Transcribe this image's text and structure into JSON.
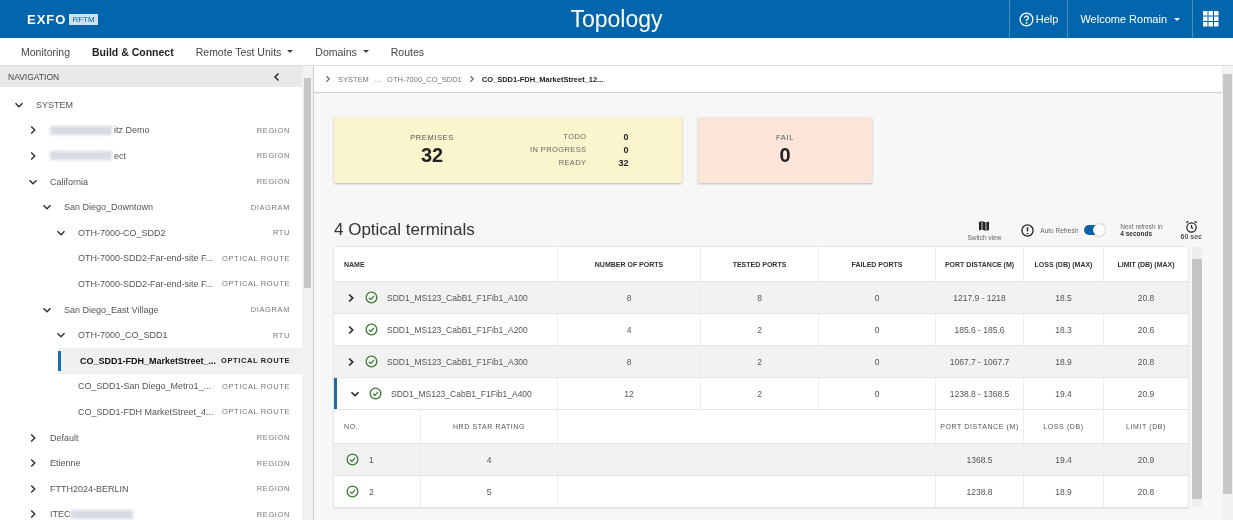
{
  "header": {
    "logo": "EXFO",
    "logo_badge": "RFTM",
    "title": "Topology",
    "help": "Help",
    "user": "Welcome Romain"
  },
  "menu": [
    {
      "label": "Monitoring",
      "selected": false,
      "dropdown": false
    },
    {
      "label": "Build & Connect",
      "selected": true,
      "dropdown": false
    },
    {
      "label": "Remote Test Units",
      "selected": false,
      "dropdown": true
    },
    {
      "label": "Domains",
      "selected": false,
      "dropdown": true
    },
    {
      "label": "Routes",
      "selected": false,
      "dropdown": false
    }
  ],
  "navigation": {
    "title": "NAVIGATION",
    "tree": [
      {
        "label": "SYSTEM",
        "kind": "group",
        "expanded": true,
        "selected": false,
        "children": [
          {
            "label": "itz Demo",
            "type": "REGION",
            "kind": "group",
            "expanded": false,
            "selected": false,
            "blurred_before": true
          },
          {
            "label": "ect",
            "type": "REGION",
            "kind": "group",
            "expanded": false,
            "selected": false,
            "blurred_before": true
          },
          {
            "label": "California",
            "type": "REGION",
            "kind": "group",
            "expanded": true,
            "selected": false,
            "children": [
              {
                "label": "San Diego_Downtown",
                "type": "DIAGRAM",
                "kind": "group",
                "expanded": true,
                "selected": false,
                "children": [
                  {
                    "label": "OTH-7000-CO_SDD2",
                    "type": "RTU",
                    "kind": "group",
                    "expanded": true,
                    "selected": false,
                    "children": [
                      {
                        "label": "OTH-7000-SDD2-Far-end-site F...",
                        "type": "OPTICAL ROUTE",
                        "kind": "leaf",
                        "selected": false
                      },
                      {
                        "label": "OTH-7000-SDD2-Far-end-site F...",
                        "type": "OPTICAL ROUTE",
                        "kind": "leaf",
                        "selected": false
                      }
                    ]
                  }
                ]
              },
              {
                "label": "San Diego_East Village",
                "type": "DIAGRAM",
                "kind": "group",
                "expanded": true,
                "selected": false,
                "children": [
                  {
                    "label": "OTH-7000_CO_SDD1",
                    "type": "RTU",
                    "kind": "group",
                    "expanded": true,
                    "selected": false,
                    "children": [
                      {
                        "label": "CO_SDD1-FDH_MarketStreet_...",
                        "type": "OPTICAL ROUTE",
                        "kind": "leaf",
                        "selected": true
                      },
                      {
                        "label": "CO_SDD1-San Diego_Metro1_...",
                        "type": "OPTICAL ROUTE",
                        "kind": "leaf",
                        "selected": false
                      },
                      {
                        "label": "CO_SDD1-FDH MarketStreet_4...",
                        "type": "OPTICAL ROUTE",
                        "kind": "leaf",
                        "selected": false
                      }
                    ]
                  }
                ]
              }
            ]
          },
          {
            "label": "Default",
            "type": "REGION",
            "kind": "group",
            "expanded": false,
            "selected": false
          },
          {
            "label": "Etienne",
            "type": "REGION",
            "kind": "group",
            "expanded": false,
            "selected": false
          },
          {
            "label": "FTTH2024-BERLIN",
            "type": "REGION",
            "kind": "group",
            "expanded": false,
            "selected": false
          },
          {
            "label": "ITEC",
            "type": "REGION",
            "kind": "group",
            "expanded": false,
            "selected": false,
            "blurred_after": true
          }
        ]
      }
    ]
  },
  "breadcrumb": [
    {
      "label": "SYSTEM",
      "current": false
    },
    {
      "label": "...",
      "current": false
    },
    {
      "label": "OTH-7000_CO_SDD1",
      "current": false
    },
    {
      "label": "CO_SDD1-FDH_MarketStreet_12...",
      "current": true
    }
  ],
  "summary": {
    "premises_label": "PREMISES",
    "premises": "32",
    "statuses": [
      {
        "label": "TODO",
        "value": "0"
      },
      {
        "label": "IN PROGRESS",
        "value": "0"
      },
      {
        "label": "READY",
        "value": "32"
      }
    ],
    "fail_label": "FAIL",
    "fail": "0"
  },
  "terminals": {
    "title": "4 Optical terminals",
    "switch_view": "Switch view",
    "auto_refresh": {
      "label": "Auto Refresh",
      "on": true
    },
    "next_refresh": "Next refresh in",
    "next_refresh_value": "4 seconds",
    "interval": "60 sec",
    "columns": [
      "NAME",
      "NUMBER OF PORTS",
      "TESTED PORTS",
      "FAILED PORTS",
      "PORT DISTANCE (M)",
      "LOSS (DB) (MAX)",
      "LIMIT (DB) (MAX)"
    ],
    "rows": [
      {
        "name": "SDD1_MS123_CabB1_F1Fib1_A100",
        "passed": true,
        "expanded": false,
        "ports": "8",
        "tested": "8",
        "failed": "0",
        "distance": "1217.9 - 1218",
        "loss": "18.5",
        "limit": "20.8"
      },
      {
        "name": "SDD1_MS123_CabB1_F1Fib1_A200",
        "passed": true,
        "expanded": false,
        "ports": "4",
        "tested": "2",
        "failed": "0",
        "distance": "185.6 - 185.6",
        "loss": "18.3",
        "limit": "20.6"
      },
      {
        "name": "SDD1_MS123_CabB1_F1Fib1_A300",
        "passed": true,
        "expanded": false,
        "ports": "8",
        "tested": "2",
        "failed": "0",
        "distance": "1067.7 - 1067.7",
        "loss": "18.9",
        "limit": "20.8"
      },
      {
        "name": "SDD1_MS123_CabB1_F1Fib1_A400",
        "passed": true,
        "expanded": true,
        "ports": "12",
        "tested": "2",
        "failed": "0",
        "distance": "1238.8 - 1368.5",
        "loss": "19.4",
        "limit": "20.9"
      }
    ],
    "detail": {
      "columns": [
        "NO.",
        "HRD STAR RATING",
        "PORT DISTANCE (M)",
        "LOSS (DB)",
        "LIMIT (DB)"
      ],
      "rows": [
        {
          "no": "1",
          "passed": true,
          "rating": "4",
          "distance": "1368.5",
          "loss": "19.4",
          "limit": "20.9"
        },
        {
          "no": "2",
          "passed": true,
          "rating": "5",
          "distance": "1238.8",
          "loss": "18.9",
          "limit": "20.8"
        }
      ]
    }
  }
}
